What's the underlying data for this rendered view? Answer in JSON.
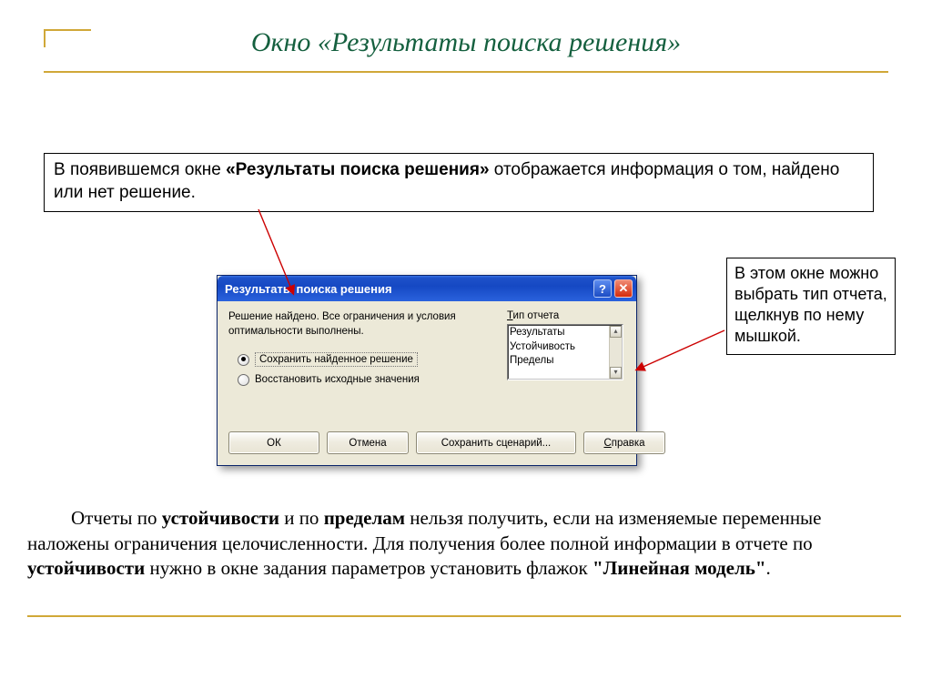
{
  "title": "Окно «Результаты поиска решения»",
  "intro": {
    "prefix": "В появившемся окне ",
    "bold": "«Результаты поиска решения»",
    "suffix": " отображается информация о том, найдено или нет решение."
  },
  "side_note": "В этом окне можно выбрать тип отчета, щелкнув по нему мышкой.",
  "dialog": {
    "title": "Результаты поиска решения",
    "status": "Решение найдено. Все ограничения и условия оптимальности выполнены.",
    "radio_keep": "Сохранить найденное решение",
    "radio_restore": "Восстановить исходные значения",
    "report_label_pre": "Т",
    "report_label_rest": "ип отчета",
    "reports": [
      "Результаты",
      "Устойчивость",
      "Пределы"
    ],
    "btn_ok": "ОК",
    "btn_cancel": "Отмена",
    "btn_save": "Сохранить сценарий...",
    "btn_help_pre": "С",
    "btn_help_rest": "правка"
  },
  "bottom": {
    "t1": "Отчеты по ",
    "b1": "устойчивости",
    "t2": " и по ",
    "b2": "пределам",
    "t3": " нельзя получить, если на изменяемые переменные наложены ограничения целочисленности. Для получения более полной информации в отчете по ",
    "b3": "устойчивости",
    "t4": " нужно в окне задания параметров установить флажок ",
    "b4": "\"Линейная модель\"",
    "t5": "."
  },
  "icons": {
    "help": "?",
    "close": "✕",
    "up": "▴",
    "down": "▾"
  }
}
